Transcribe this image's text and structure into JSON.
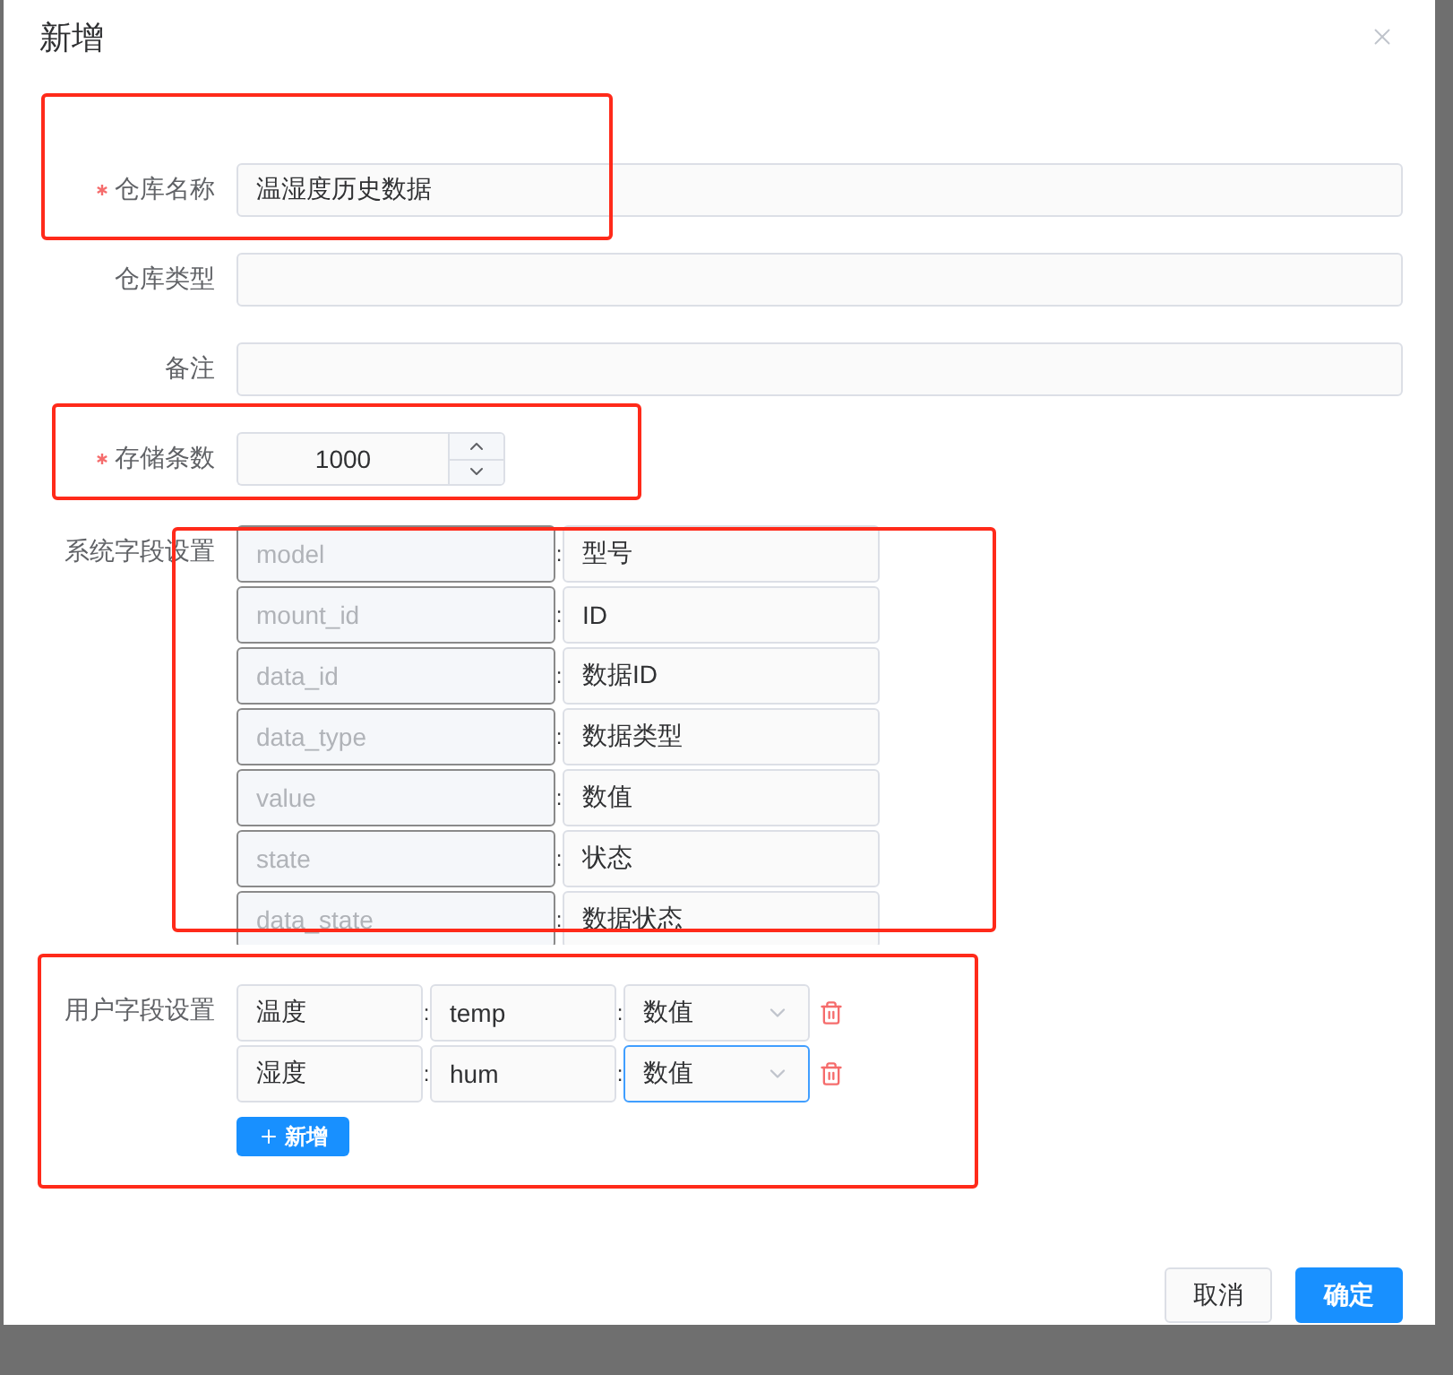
{
  "dialog": {
    "title": "新增"
  },
  "fields": [
    {
      "label": "仓库名称",
      "required": true,
      "kind": "text",
      "value": "温湿度历史数据"
    },
    {
      "label": "仓库类型",
      "required": false,
      "kind": "text"
    },
    {
      "label": "备注",
      "required": false,
      "kind": "text"
    },
    {
      "label": "存储条数",
      "required": true,
      "kind": "number",
      "value": "1000"
    }
  ],
  "system_fields": {
    "label": "系统字段设置",
    "rows": [
      {
        "placeholder": "model",
        "separator": ":",
        "value": "型号"
      },
      {
        "placeholder": "mount_id",
        "separator": ":",
        "value": "ID"
      },
      {
        "placeholder": "data_id",
        "separator": ":",
        "value": "数据ID"
      },
      {
        "placeholder": "data_type",
        "separator": ":",
        "value": "数据类型"
      },
      {
        "placeholder": "value",
        "separator": ":",
        "value": "数值"
      },
      {
        "placeholder": "state",
        "separator": ":",
        "value": "状态"
      },
      {
        "placeholder": "data_state",
        "separator": ":",
        "value": "数据状态"
      }
    ]
  },
  "user_fields": {
    "label": "用户字段设置",
    "rows": [
      {
        "name": "温度",
        "separator_1": ":",
        "key": "temp",
        "separator_2": ":",
        "type": "数值",
        "focused": false
      },
      {
        "name": "湿度",
        "separator_1": ":",
        "key": "hum",
        "separator_2": ":",
        "type": "数值",
        "focused": true
      }
    ],
    "add_button": "新增"
  },
  "footer": {
    "cancel": "取消",
    "confirm": "确定"
  },
  "annotations": [
    {
      "kind": "rect"
    },
    {
      "kind": "rect"
    },
    {
      "kind": "rect"
    },
    {
      "kind": "rect"
    }
  ]
}
